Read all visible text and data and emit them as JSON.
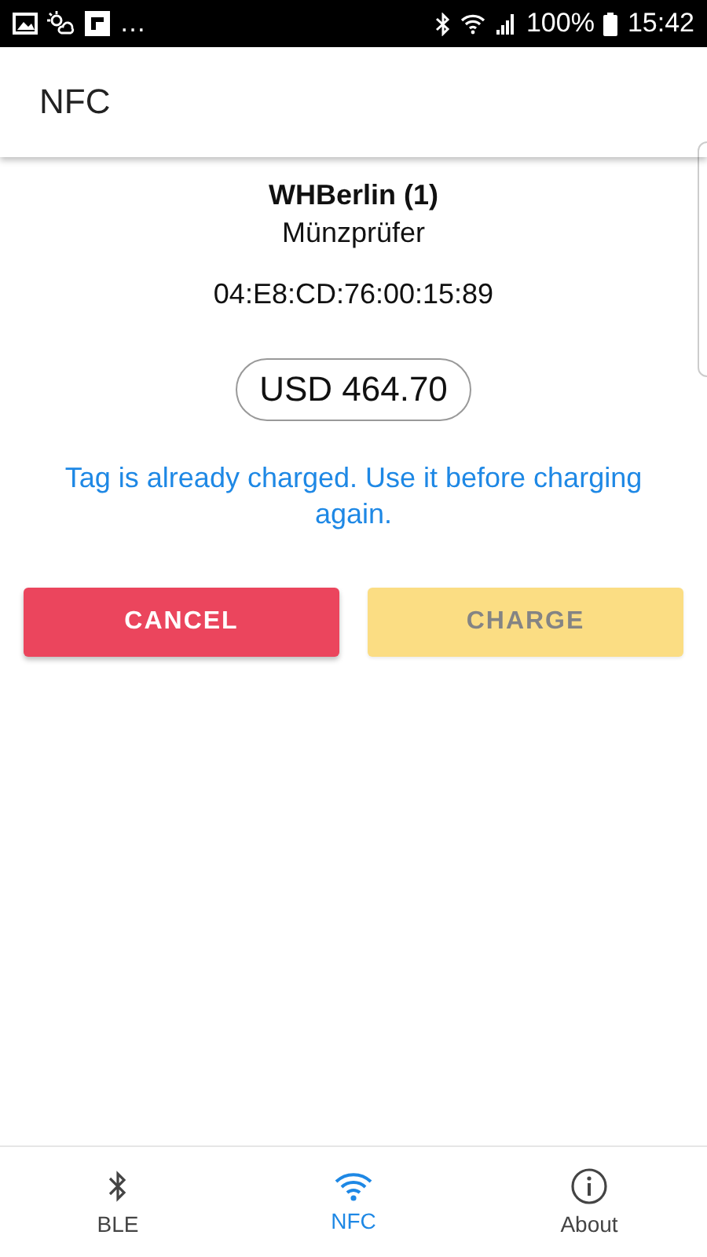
{
  "status_bar": {
    "more": "…",
    "battery": "100%",
    "time": "15:42"
  },
  "app_bar": {
    "title": "NFC"
  },
  "tag": {
    "name": "WHBerlin (1)",
    "type": "Münzprüfer",
    "uid": "04:E8:CD:76:00:15:89",
    "balance": "USD 464.70",
    "message": "Tag is already charged. Use it before charging again."
  },
  "buttons": [
    {
      "kind": "cancel",
      "label": "CANCEL",
      "disabled": false
    },
    {
      "kind": "charge",
      "label": "CHARGE",
      "disabled": true
    }
  ],
  "bottom_nav": [
    {
      "kind": "bluetooth",
      "label": "BLE",
      "selected": false
    },
    {
      "kind": "wifi",
      "label": "NFC",
      "selected": true
    },
    {
      "kind": "info",
      "label": "About",
      "selected": false
    }
  ]
}
